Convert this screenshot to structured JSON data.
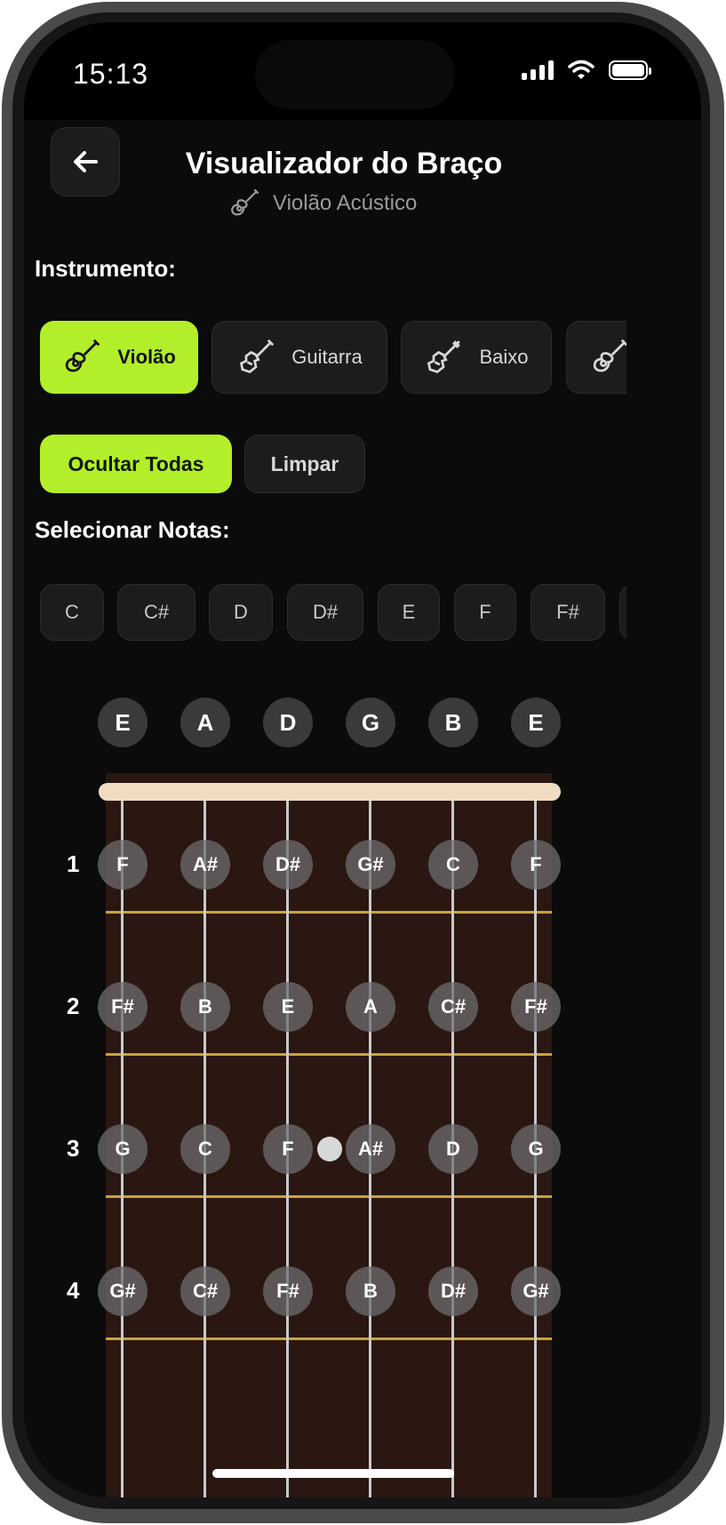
{
  "status_bar": {
    "time": "15:13"
  },
  "header": {
    "title": "Visualizador do Braço",
    "subtitle": "Violão Acústico",
    "subtitle_icon": "guitar-icon"
  },
  "instrument_section": {
    "label": "Instrumento:",
    "items": [
      {
        "label": "Violão",
        "icon": "acoustic-guitar-icon",
        "active": true
      },
      {
        "label": "Guitarra",
        "icon": "electric-guitar-icon",
        "active": false
      },
      {
        "label": "Baixo",
        "icon": "bass-icon",
        "active": false
      },
      {
        "label": "",
        "icon": "acoustic-guitar-icon",
        "active": false
      }
    ]
  },
  "actions": {
    "hide_all": "Ocultar Todas",
    "clear": "Limpar"
  },
  "notes_section": {
    "label": "Selecionar Notas:",
    "notes": [
      "C",
      "C#",
      "D",
      "D#",
      "E",
      "F",
      "F#",
      ""
    ]
  },
  "fretboard": {
    "open_strings": [
      "E",
      "A",
      "D",
      "G",
      "B",
      "E"
    ],
    "frets": [
      {
        "number": "1",
        "notes": [
          "F",
          "A#",
          "D#",
          "G#",
          "C",
          "F"
        ]
      },
      {
        "number": "2",
        "notes": [
          "F#",
          "B",
          "E",
          "A",
          "C#",
          "F#"
        ]
      },
      {
        "number": "3",
        "notes": [
          "G",
          "C",
          "F",
          "A#",
          "D",
          "G"
        ]
      },
      {
        "number": "4",
        "notes": [
          "G#",
          "C#",
          "F#",
          "B",
          "D#",
          "G#"
        ]
      }
    ],
    "inlay_frets": [
      3
    ]
  },
  "colors": {
    "accent": "#b3ee2b",
    "nut": "#f0dcc0",
    "fret_wire": "#c9a23b",
    "wood": "#2a1712"
  }
}
